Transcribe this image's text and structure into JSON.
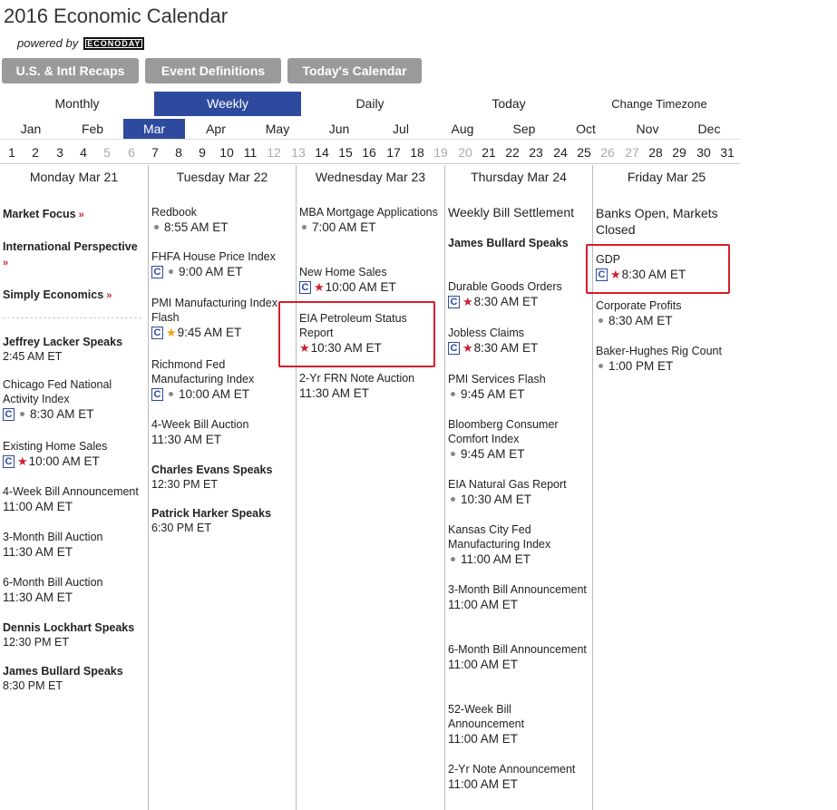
{
  "header": {
    "title": "2016 Economic Calendar",
    "powered_by": "powered by",
    "logo_text": "ECONODAY"
  },
  "buttons": [
    "U.S. & Intl Recaps",
    "Event Definitions",
    "Today's Calendar"
  ],
  "modes": [
    "Monthly",
    "Weekly",
    "Daily",
    "Today",
    "Change Timezone"
  ],
  "active_mode": "Weekly",
  "months": [
    "Jan",
    "Feb",
    "Mar",
    "Apr",
    "May",
    "Jun",
    "Jul",
    "Aug",
    "Sep",
    "Oct",
    "Nov",
    "Dec"
  ],
  "active_month": "Mar",
  "days": [
    "1",
    "2",
    "3",
    "4",
    "5",
    "6",
    "7",
    "8",
    "9",
    "10",
    "11",
    "12",
    "13",
    "14",
    "15",
    "16",
    "17",
    "18",
    "19",
    "20",
    "21",
    "22",
    "23",
    "24",
    "25",
    "26",
    "27",
    "28",
    "29",
    "30",
    "31"
  ],
  "muted_days": [
    "5",
    "6",
    "12",
    "13",
    "19",
    "20",
    "26",
    "27"
  ],
  "colors": {
    "accent": "#2e4a9e",
    "button": "#9a9a9a",
    "star_red": "#cc1f2e",
    "star_gold": "#f0a30a",
    "highlight": "#d61d2a"
  },
  "columns": [
    {
      "heading": "Monday Mar 21",
      "events": [
        {
          "name": "Market Focus",
          "link": true
        },
        {
          "name": "International Perspective",
          "link": true
        },
        {
          "name": "Simply Economics",
          "link": true
        },
        {
          "name": "Jeffrey Lacker Speaks",
          "bold": true,
          "time": "2:45 AM ET"
        },
        {
          "name": "Chicago Fed National Activity Index",
          "c": true,
          "dot": true,
          "time": "8:30 AM ET"
        },
        {
          "name": "Existing Home Sales",
          "c": true,
          "star": "red",
          "time": "10:00 AM ET"
        },
        {
          "name": "4-Week Bill Announcement",
          "time": "11:00 AM ET"
        },
        {
          "name": "3-Month Bill Auction",
          "time": "11:30 AM ET"
        },
        {
          "name": "6-Month Bill Auction",
          "time": "11:30 AM ET"
        },
        {
          "name": "Dennis Lockhart Speaks",
          "bold": true,
          "time": "12:30 PM ET"
        },
        {
          "name": "James Bullard Speaks",
          "bold": true,
          "time": "8:30 PM ET"
        }
      ]
    },
    {
      "heading": "Tuesday Mar 22",
      "events": [
        {
          "name": "Redbook",
          "dot": true,
          "time": "8:55 AM ET"
        },
        {
          "name": "FHFA House Price Index",
          "c": true,
          "dot": true,
          "time": "9:00 AM ET"
        },
        {
          "name": "PMI Manufacturing Index Flash",
          "c": true,
          "star": "gold",
          "time": "9:45 AM ET"
        },
        {
          "name": "Richmond Fed Manufacturing Index",
          "c": true,
          "dot": true,
          "time": "10:00 AM ET"
        },
        {
          "name": "4-Week Bill Auction",
          "time": "11:30 AM ET"
        },
        {
          "name": "Charles Evans Speaks",
          "bold": true,
          "time": "12:30 PM ET"
        },
        {
          "name": "Patrick Harker Speaks",
          "bold": true,
          "time": "6:30 PM ET"
        }
      ]
    },
    {
      "heading": "Wednesday Mar 23",
      "events": [
        {
          "name": "MBA Mortgage Applications",
          "dot": true,
          "time": "7:00 AM ET"
        },
        {
          "name": "New Home Sales",
          "c": true,
          "star": "red",
          "time": "10:00 AM ET"
        },
        {
          "name": "EIA Petroleum Status Report",
          "star": "red",
          "time": "10:30 AM ET"
        },
        {
          "name": "2-Yr FRN Note Auction",
          "time": "11:30 AM ET"
        }
      ]
    },
    {
      "heading": "Thursday Mar 24",
      "events": [
        {
          "name": "Weekly Bill Settlement"
        },
        {
          "name": "James Bullard Speaks",
          "bold": true
        },
        {
          "name": "Durable Goods Orders",
          "c": true,
          "star": "red",
          "time": "8:30 AM ET"
        },
        {
          "name": "Jobless Claims",
          "c": true,
          "star": "red",
          "time": "8:30 AM ET"
        },
        {
          "name": "PMI Services Flash",
          "dot": true,
          "time": "9:45 AM ET"
        },
        {
          "name": "Bloomberg Consumer Comfort Index",
          "dot": true,
          "time": "9:45 AM ET"
        },
        {
          "name": "EIA Natural Gas Report",
          "dot": true,
          "time": "10:30 AM ET"
        },
        {
          "name": "Kansas City Fed Manufacturing Index",
          "dot": true,
          "time": "11:00 AM ET"
        },
        {
          "name": "3-Month Bill Announcement",
          "time": "11:00 AM ET"
        },
        {
          "name": "6-Month Bill Announcement",
          "time": "11:00 AM ET"
        },
        {
          "name": "52-Week Bill Announcement",
          "time": "11:00 AM ET"
        },
        {
          "name": "2-Yr Note Announcement",
          "time": "11:00 AM ET"
        }
      ]
    },
    {
      "heading": "Friday Mar 25",
      "events": [
        {
          "name": "Banks Open, Markets Closed"
        },
        {
          "name": "GDP",
          "c": true,
          "star": "red",
          "time": "8:30 AM ET"
        },
        {
          "name": "Corporate Profits",
          "dot": true,
          "time": "8:30 AM ET"
        },
        {
          "name": "Baker-Hughes Rig Count",
          "dot": true,
          "time": "1:00 PM ET"
        }
      ]
    }
  ]
}
